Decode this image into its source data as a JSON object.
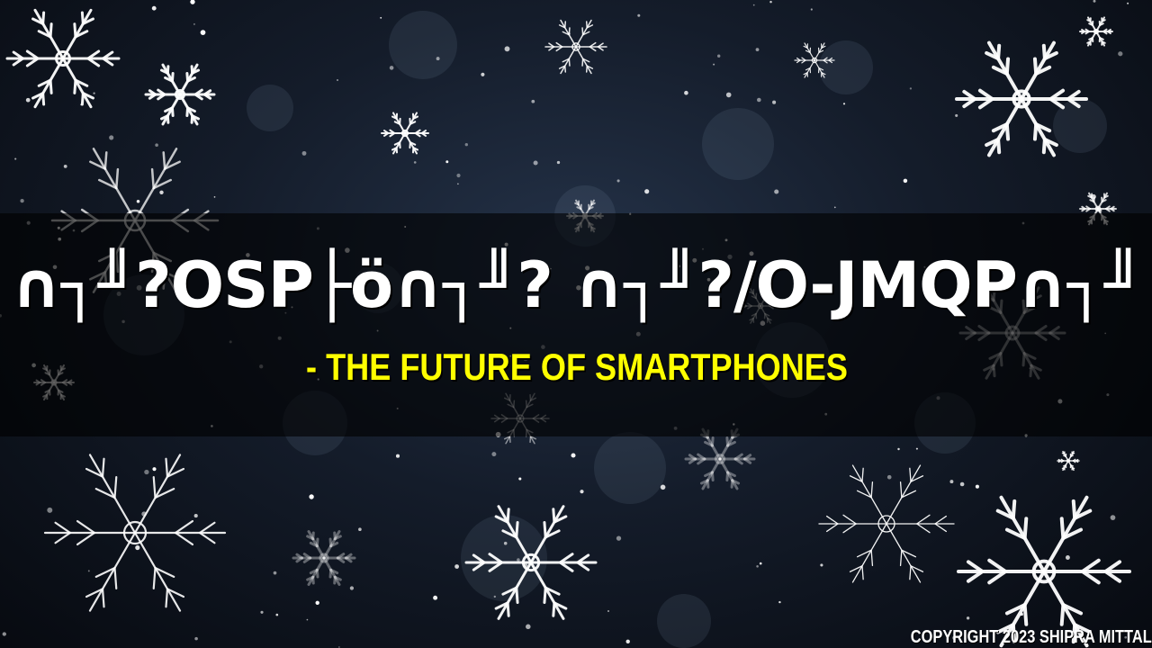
{
  "background": {
    "description_colors": {
      "sky_dark": "#0a0f18",
      "sky_mid": "#243248",
      "flake": "#ffffff"
    }
  },
  "title": {
    "text": "∩┐╜?OSP├ö∩┐╜? ∩┐╜?/O-JMQP∩┐╜"
  },
  "subtitle": {
    "text": "- THE FUTURE OF SMARTPHONES",
    "color": "#ffff00"
  },
  "footer": {
    "copyright": "COPYRIGHT 2023 SHIPRA MITTAL"
  }
}
